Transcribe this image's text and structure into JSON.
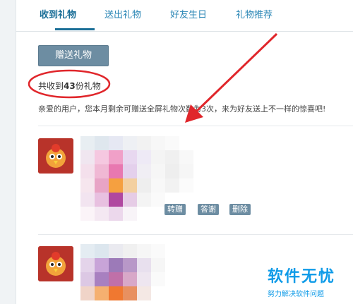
{
  "tabs": [
    {
      "label": "收到礼物",
      "active": true
    },
    {
      "label": "送出礼物",
      "active": false
    },
    {
      "label": "好友生日",
      "active": false
    },
    {
      "label": "礼物推荐",
      "active": false
    }
  ],
  "gift_button_label": "赠送礼物",
  "received": {
    "prefix": "共收到",
    "count": "43",
    "suffix": "份礼物"
  },
  "notice": "亲爱的用户，您本月剩余可赠送全屏礼物次数为3次，来为好友送上不一样的惊喜吧!",
  "actions": {
    "forward": "转赠",
    "thank": "答谢",
    "delete": "删除"
  },
  "watermark": {
    "main": "软件无忧",
    "sub": "努力解决软件问题"
  },
  "colors": {
    "accent": "#1a6e97",
    "button": "#6d8da2",
    "annotation": "#e0262b",
    "watermark": "#0f9be8"
  },
  "icons": {
    "avatar": "cartoon-rooster-avatar"
  }
}
